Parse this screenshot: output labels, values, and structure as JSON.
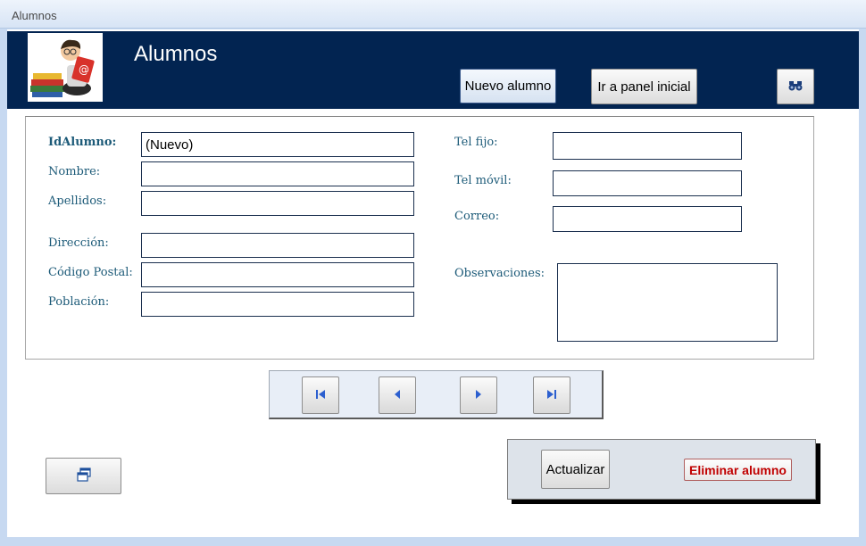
{
  "window": {
    "tab_title": "Alumnos"
  },
  "header": {
    "title": "Alumnos",
    "new_button": "Nuevo alumno",
    "panel_button": "Ir a panel inicial",
    "search_icon": "binoculars-icon"
  },
  "fields_left": [
    {
      "label": "IdAlumno:",
      "value": "(Nuevo)"
    },
    {
      "label": "Nombre:",
      "value": ""
    },
    {
      "label": "Apellidos:",
      "value": ""
    },
    {
      "label": "Dirección:",
      "value": ""
    },
    {
      "label": "Código Postal:",
      "value": ""
    },
    {
      "label": "Población:",
      "value": ""
    }
  ],
  "fields_right": [
    {
      "label": "Tel fijo:",
      "value": ""
    },
    {
      "label": "Tel móvil:",
      "value": ""
    },
    {
      "label": "Correo:",
      "value": ""
    },
    {
      "label": "Observaciones:",
      "value": ""
    }
  ],
  "navigation": {
    "first_icon": "first-record-icon",
    "prev_icon": "previous-record-icon",
    "next_icon": "next-record-icon",
    "last_icon": "last-record-icon"
  },
  "actions": {
    "update_button": "Actualizar",
    "delete_button": "Eliminar alumno",
    "window_icon": "switch-windows-icon"
  },
  "colors": {
    "header_bg": "#022451",
    "label_text": "#1c5a78",
    "delete_text": "#c00000"
  }
}
